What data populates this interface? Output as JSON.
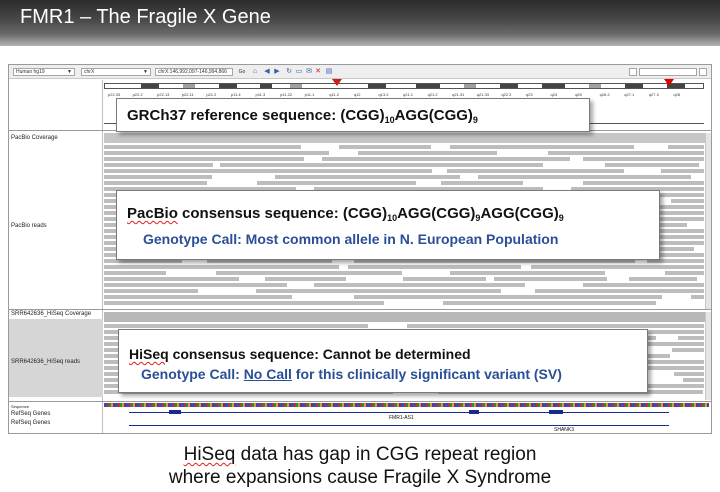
{
  "slide": {
    "title": "FMR1 – The Fragile X Gene"
  },
  "igv": {
    "toolbar": {
      "genome": "Human hg19",
      "chromosome": "chrX",
      "locus": "chrX:146,992,097-146,994,866",
      "go_label": "Go"
    },
    "tracks": {
      "pacbio_coverage": "PacBio Coverage",
      "pacbio_reads": "PacBio reads",
      "hiseq_coverage": "SRR642636_HiSeq Coverage",
      "hiseq_reads": "SRR642636_HiSeq reads",
      "sequence": "Sequence",
      "refseq_genes": "RefSeq Genes",
      "refseq_genes_2": "RefSeq Genes"
    },
    "ideogram_bands": [
      "p22.33",
      "p22.2",
      "p22.13",
      "p22.11",
      "p21.2",
      "p11.4",
      "p11.3",
      "p11.22",
      "p11.1",
      "q11.2",
      "q12",
      "q13.2",
      "q21.1",
      "q21.2",
      "q21.31",
      "q21.33",
      "q22.2",
      "q23",
      "q24",
      "q25",
      "q26.2",
      "q27.1",
      "q27.3",
      "q28"
    ],
    "genes": {
      "gene1": "FMR1-AS1",
      "gene2": "SHANK3"
    }
  },
  "callouts": {
    "grch37": {
      "prefix": "GRCh37 reference sequence:  (CGG)",
      "sub1": "10",
      "mid": "AGG(CGG)",
      "sub2": "9"
    },
    "pacbio": {
      "word": "PacBio",
      "prefix": " consensus sequence:  (CGG)",
      "sub1": "10",
      "mid1": "AGG(CGG)",
      "sub2": "9",
      "mid2": "AGG(CGG)",
      "sub3": "9",
      "genotype": "Genotype Call:  Most common allele in N. European Population"
    },
    "hiseq": {
      "word": "HiSeq",
      "rest": " consensus sequence:  Cannot be determined",
      "genotype_pre": "Genotype Call: ",
      "genotype_ul": "No Call",
      "genotype_post": " for this clinically significant variant (SV)"
    }
  },
  "caption": {
    "line1_word": "HiSeq",
    "line1_rest": " data has gap in CGG repeat region",
    "line2": "where expansions cause Fragile X Syndrome"
  }
}
